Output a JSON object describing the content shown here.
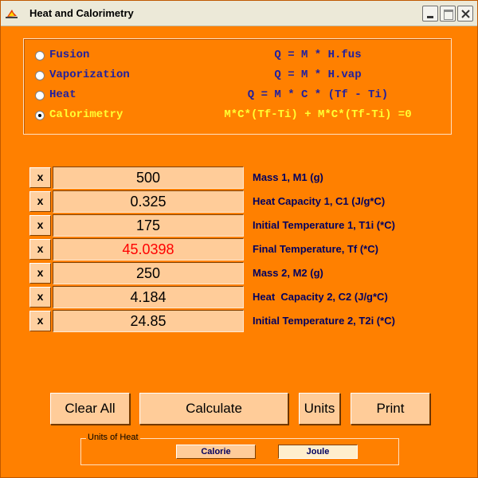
{
  "window": {
    "title": "Heat and Calorimetry"
  },
  "formulas": [
    {
      "label": "Fusion",
      "formula": "Q = M * H.fus",
      "checked": false
    },
    {
      "label": "Vaporization",
      "formula": "Q = M * H.vap",
      "checked": false
    },
    {
      "label": "Heat",
      "formula": "Q = M * C * (Tf - Ti)",
      "checked": false
    },
    {
      "label": "Calorimetry",
      "formula": "M*C*(Tf-Ti) + M*C*(Tf-Ti) =0",
      "checked": true
    }
  ],
  "fields": [
    {
      "clear": "x",
      "value": "500",
      "label": "Mass 1, M1 (g)"
    },
    {
      "clear": "x",
      "value": "0.325",
      "label": "Heat Capacity 1, C1 (J/g*C)"
    },
    {
      "clear": "x",
      "value": "175",
      "label": "Initial Temperature 1, T1i (*C)"
    },
    {
      "clear": "x",
      "value": "45.0398",
      "label": "Final Temperature, Tf (*C)"
    },
    {
      "clear": "x",
      "value": "250",
      "label": "Mass 2, M2 (g)"
    },
    {
      "clear": "x",
      "value": "4.184",
      "label": "Heat  Capacity 2, C2 (J/g*C)"
    },
    {
      "clear": "x",
      "value": "24.85",
      "label": "Initial Temperature 2, T2i (*C)"
    }
  ],
  "buttons": {
    "clear_all": "Clear All",
    "calculate": "Calculate",
    "units": "Units",
    "print": "Print"
  },
  "units_of_heat": {
    "legend": "Units of Heat",
    "calorie": "Calorie",
    "joule": "Joule",
    "selected": "Joule"
  },
  "colors": {
    "background": "#FF8000",
    "active_formula": "#FFFF33",
    "formula_text": "#2020A0",
    "result_value": "#FF0000"
  }
}
